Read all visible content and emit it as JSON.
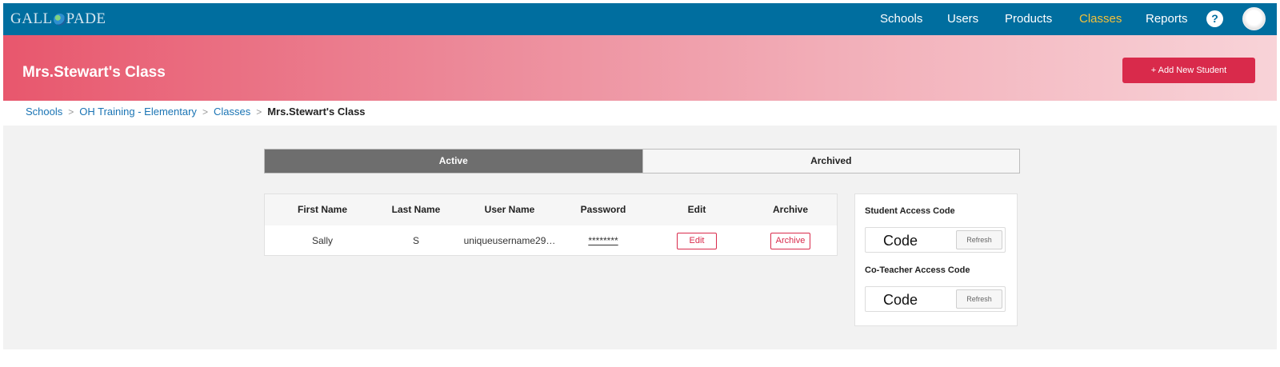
{
  "brand": {
    "logo_before": "GALL",
    "logo_after": "PADE"
  },
  "nav": {
    "links": [
      {
        "label": "Schools",
        "active": false
      },
      {
        "label": "Users",
        "active": false
      },
      {
        "label": "Products",
        "active": false
      },
      {
        "label": "Classes",
        "active": true
      },
      {
        "label": "Reports",
        "active": false
      }
    ],
    "help_label": "?"
  },
  "hero": {
    "title": "Mrs.Stewart's Class",
    "add_button_label": "+ Add New Student"
  },
  "breadcrumb": {
    "items": [
      "Schools",
      "OH Training - Elementary",
      "Classes"
    ],
    "current": "Mrs.Stewart's Class",
    "separator": ">"
  },
  "tabs": [
    {
      "label": "Active",
      "selected": true
    },
    {
      "label": "Archived",
      "selected": false
    }
  ],
  "table": {
    "columns": [
      "First Name",
      "Last Name",
      "User Name",
      "Password",
      "Edit",
      "Archive"
    ],
    "rows": [
      {
        "first_name": "Sally",
        "last_name": "S",
        "user_name": "uniqueusername29…",
        "password": "********",
        "edit_label": "Edit",
        "archive_label": "Archive"
      }
    ]
  },
  "access_codes": {
    "student": {
      "label": "Student Access Code",
      "code": "Code",
      "refresh_label": "Refresh"
    },
    "coteacher": {
      "label": "Co-Teacher Access Code",
      "code": "Code",
      "refresh_label": "Refresh"
    }
  },
  "colors": {
    "nav_bg": "#006e9f",
    "nav_active": "#f3c13a",
    "accent": "#d92a4b",
    "link": "#1a74b4"
  },
  "icons": {
    "help": "help-circle-icon",
    "avatar": "user-avatar-icon"
  }
}
